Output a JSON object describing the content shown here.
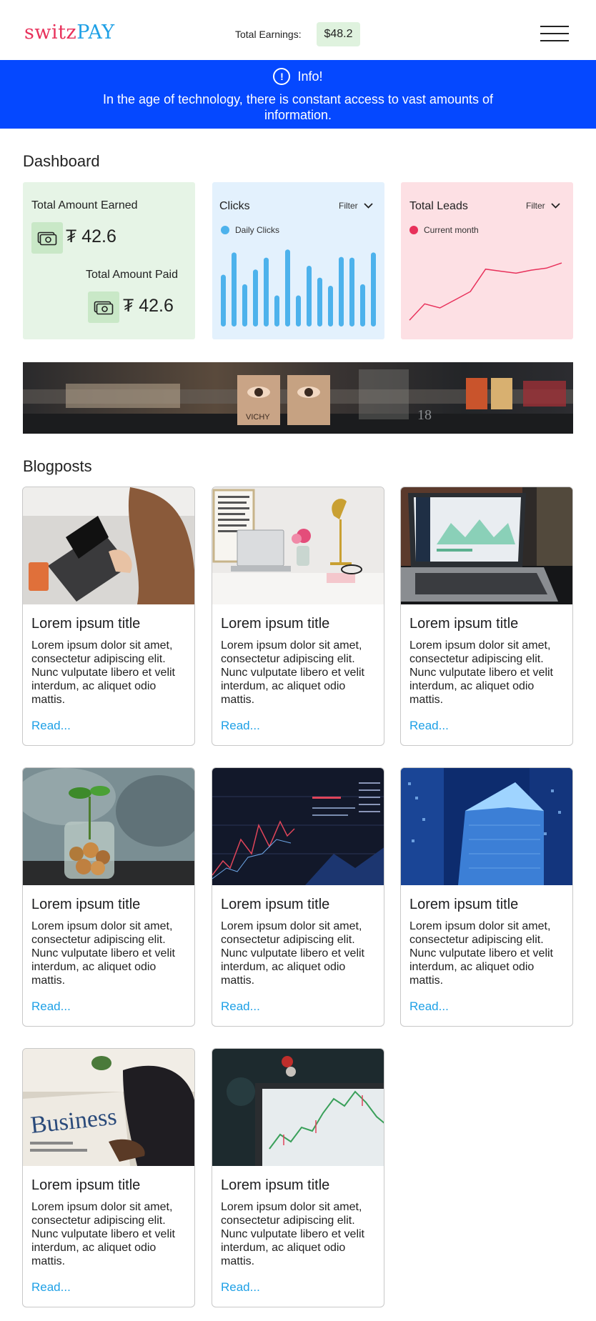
{
  "header": {
    "logo_part1": "switz",
    "logo_part2": "PAY",
    "earnings_label": "Total Earnings:",
    "earnings_value": "$48.2"
  },
  "info": {
    "title": "Info!",
    "icon": "!",
    "message": "In the age of technology, there is constant access to vast amounts of information."
  },
  "dashboard": {
    "title": "Dashboard",
    "earned_label": "Total Amount Earned",
    "earned_value": "₮ 42.6",
    "paid_label": "Total Amount Paid",
    "paid_value": "₮ 42.6",
    "clicks": {
      "title": "Clicks",
      "filter": "Filter",
      "legend": "Daily Clicks",
      "color": "#4db2ec"
    },
    "leads": {
      "title": "Total Leads",
      "filter": "Filter",
      "legend": "Current month",
      "color": "#e8315b"
    }
  },
  "chart_data": [
    {
      "type": "bar",
      "title": "Clicks",
      "series": [
        {
          "name": "Daily Clicks",
          "values": [
            70,
            100,
            57,
            77,
            93,
            42,
            104,
            42,
            82,
            66,
            55,
            94,
            93,
            57,
            100
          ]
        }
      ],
      "ylim": [
        0,
        110
      ],
      "grid": false,
      "legend": "top-left"
    },
    {
      "type": "line",
      "title": "Total Leads",
      "series": [
        {
          "name": "Current month",
          "values": [
            2,
            18,
            14,
            22,
            30,
            52,
            50,
            48,
            51,
            53,
            58
          ]
        }
      ],
      "ylim": [
        0,
        70
      ],
      "grid": false,
      "legend": "top-left"
    }
  ],
  "blog": {
    "title": "Blogposts",
    "posts": [
      {
        "title": "Lorem ipsum title",
        "body": "Lorem ipsum dolor sit amet, consectetur adipiscing elit. Nunc vulputate libero et velit interdum, ac aliquet odio mattis.",
        "link": "Read..."
      },
      {
        "title": "Lorem ipsum title",
        "body": "Lorem ipsum dolor sit amet, consectetur adipiscing elit. Nunc vulputate libero et velit interdum, ac aliquet odio mattis.",
        "link": "Read..."
      },
      {
        "title": "Lorem ipsum title",
        "body": "Lorem ipsum dolor sit amet, consectetur adipiscing elit. Nunc vulputate libero et velit interdum, ac aliquet odio mattis.",
        "link": "Read..."
      },
      {
        "title": "Lorem ipsum title",
        "body": "Lorem ipsum dolor sit amet, consectetur adipiscing elit. Nunc vulputate libero et velit interdum, ac aliquet odio mattis.",
        "link": "Read..."
      },
      {
        "title": "Lorem ipsum title",
        "body": "Lorem ipsum dolor sit amet, consectetur adipiscing elit. Nunc vulputate libero et velit interdum, ac aliquet odio mattis.",
        "link": "Read..."
      },
      {
        "title": "Lorem ipsum title",
        "body": "Lorem ipsum dolor sit amet, consectetur adipiscing elit. Nunc vulputate libero et velit interdum, ac aliquet odio mattis.",
        "link": "Read..."
      },
      {
        "title": "Lorem ipsum title",
        "body": "Lorem ipsum dolor sit amet, consectetur adipiscing elit. Nunc vulputate libero et velit interdum, ac aliquet odio mattis.",
        "link": "Read..."
      },
      {
        "title": "Lorem ipsum title",
        "body": "Lorem ipsum dolor sit amet, consectetur adipiscing elit. Nunc vulputate libero et velit interdum, ac aliquet odio mattis.",
        "link": "Read..."
      }
    ]
  },
  "hero_text": [
    "VICHY",
    "18"
  ]
}
